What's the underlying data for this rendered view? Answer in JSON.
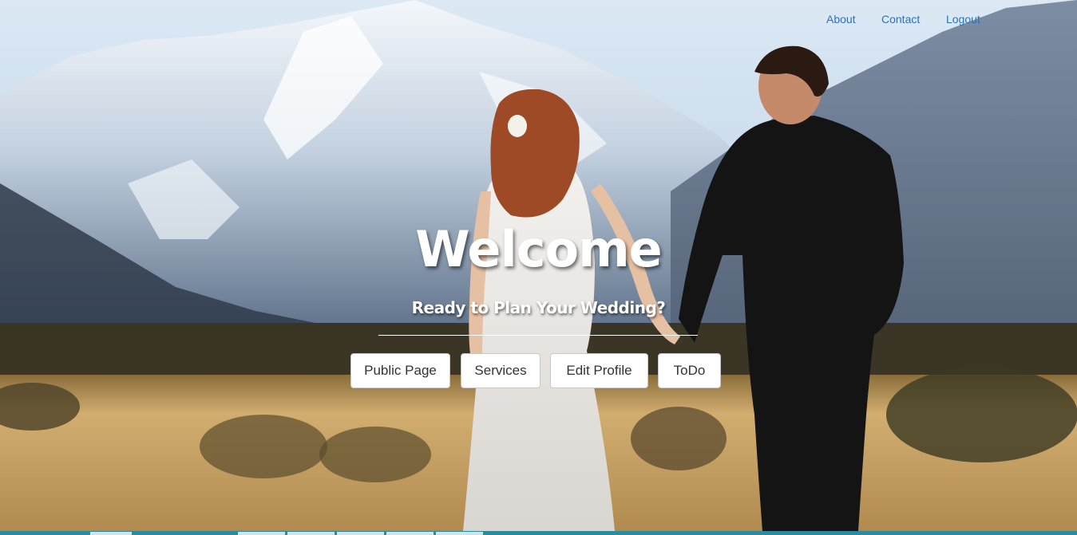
{
  "nav": {
    "about": "About",
    "contact": "Contact",
    "logout": "Logout"
  },
  "hero": {
    "title": "Welcome",
    "subtitle": "Ready to Plan Your Wedding?",
    "image": "couple-walking-mountain-field-photo"
  },
  "buttons": {
    "public_page": "Public Page",
    "services": "Services",
    "edit_profile": "Edit Profile",
    "todo": "ToDo"
  },
  "colors": {
    "nav_link": "#2c72b8",
    "button_bg": "#ffffff",
    "button_text": "#333333",
    "hero_text": "#ffffff",
    "taskbar": "#2a8aa0"
  }
}
